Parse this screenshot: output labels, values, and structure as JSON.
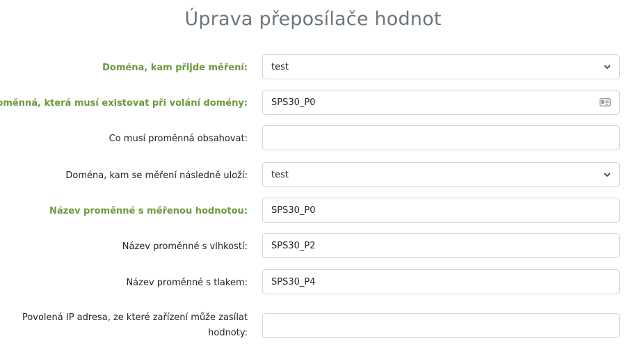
{
  "page": {
    "title": "Úprava přeposílače hodnot"
  },
  "form": {
    "domain_in": {
      "label": "Doména, kam přijde měření:",
      "value": "test"
    },
    "trigger_var": {
      "label": "Proměnná, která musí existovat při volání domény:",
      "value": "SPS30_P0"
    },
    "var_content": {
      "label": "Co musí proměnná obsahovat:",
      "value": ""
    },
    "domain_out": {
      "label": "Doména, kam se měření následně uloží:",
      "value": "test"
    },
    "measured_var": {
      "label": "Název proměnné s měřenou hodnotou:",
      "value": "SPS30_P0"
    },
    "humidity_var": {
      "label": "Název proměnné s vlhkostí:",
      "value": "SPS30_P2"
    },
    "pressure_var": {
      "label": "Název proměnné s tlakem:",
      "value": "SPS30_P4"
    },
    "allowed_ip": {
      "label": "Povolená IP adresa, ze které zařízení může zasílat hodnoty:",
      "value": ""
    }
  },
  "colors": {
    "required_label": "#6a9a3c",
    "title": "#6c757d",
    "border": "#ced4da"
  },
  "icons": {
    "select_indicator": "chevron-down-icon",
    "autofill_indicator": "contact-card-icon"
  }
}
